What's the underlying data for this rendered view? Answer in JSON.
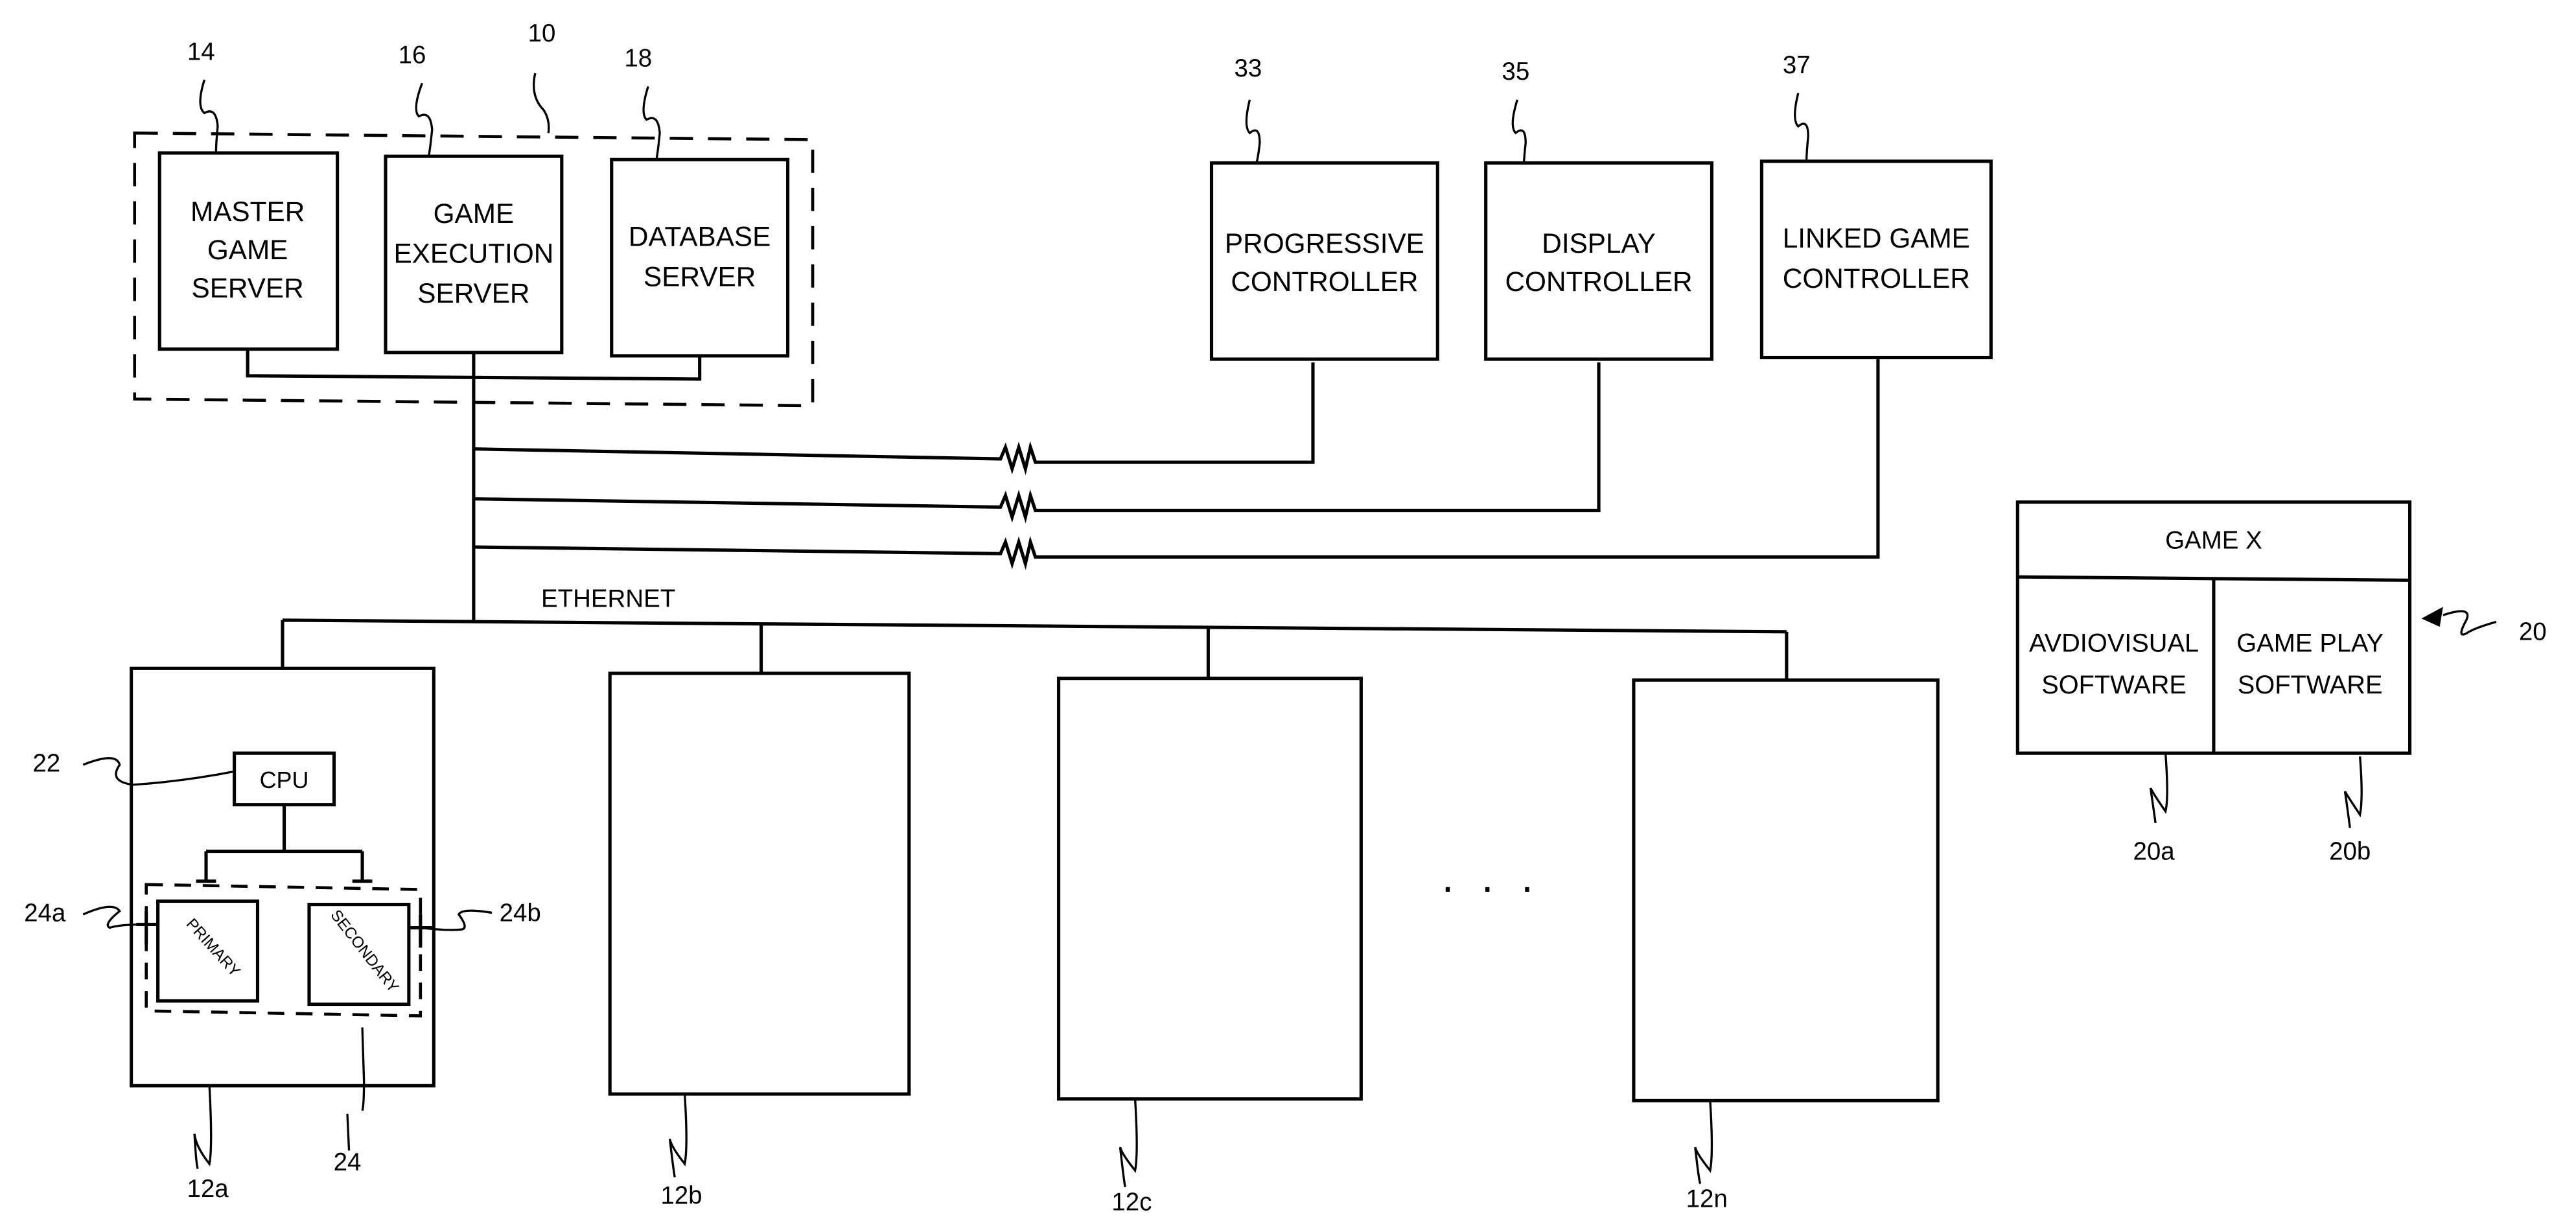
{
  "figure": {
    "system_ref": "10",
    "servers": [
      {
        "ref": "14",
        "lines": [
          "MASTER",
          "GAME",
          "SERVER"
        ]
      },
      {
        "ref": "16",
        "lines": [
          "GAME",
          "EXECUTION",
          "SERVER"
        ]
      },
      {
        "ref": "18",
        "lines": [
          "DATABASE",
          "SERVER"
        ]
      }
    ],
    "controllers": [
      {
        "ref": "33",
        "lines": [
          "PROGRESSIVE",
          "CONTROLLER"
        ]
      },
      {
        "ref": "35",
        "lines": [
          "DISPLAY",
          "CONTROLLER"
        ]
      },
      {
        "ref": "37",
        "lines": [
          "LINKED GAME",
          "CONTROLLER"
        ]
      }
    ],
    "network_label": "ETHERNET",
    "terminals": [
      {
        "ref": "12a"
      },
      {
        "ref": "12b"
      },
      {
        "ref": "12c"
      },
      {
        "ref": "12n"
      }
    ],
    "ellipsis": "· · ·",
    "terminal_detail": {
      "cpu_ref": "22",
      "cpu_label": "CPU",
      "memory_ref": "24",
      "primary_ref": "24a",
      "primary_label": "PRIMARY",
      "secondary_ref": "24b",
      "secondary_label": "SECONDARY"
    },
    "game": {
      "ref": "20",
      "title": "GAME X",
      "left_lines": [
        "AVDIOVISUAL",
        "SOFTWARE"
      ],
      "left_ref": "20a",
      "right_lines": [
        "GAME PLAY",
        "SOFTWARE"
      ],
      "right_ref": "20b"
    }
  }
}
